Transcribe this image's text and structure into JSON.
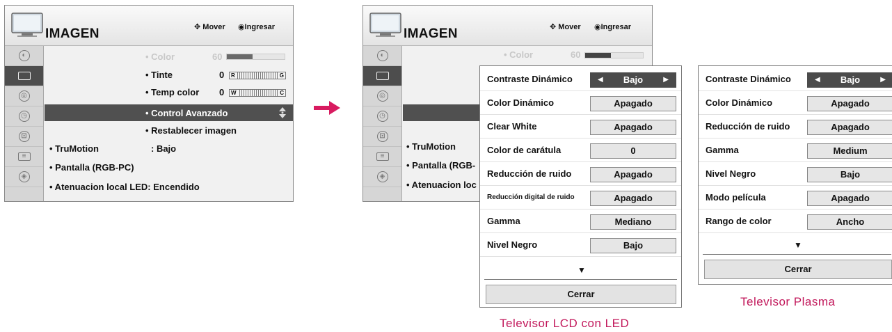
{
  "menu": {
    "title": "IMAGEN",
    "hint_move": "Mover",
    "hint_enter": "Ingresar",
    "sidebar_icons": [
      "picture-settings-icon",
      "picture-icon",
      "audio-icon",
      "time-icon",
      "lock-icon",
      "option-icon",
      "input-icon"
    ],
    "selected_icon_index": 1,
    "items": {
      "color": "• Color",
      "color_value": "60",
      "color_level": 0.6,
      "tint": "• Tinte",
      "tint_value": "0",
      "tint_left": "R",
      "tint_right": "G",
      "temp": "• Temp color",
      "temp_value": "0",
      "temp_left": "W",
      "temp_right": "C",
      "advanced": "• Control Avanzado",
      "reset": "• Restablecer imagen",
      "trumotion": "• TruMotion",
      "trumotion_value": ": Bajo",
      "screen": "• Pantalla (RGB-PC)",
      "led": "• Atenuacion local LED: Encendido"
    },
    "partial": {
      "trumotion": "• TruMotion",
      "screen": "• Pantalla (RGB-",
      "led": "• Atenuacion loc"
    }
  },
  "lcd_popup": {
    "rows": [
      {
        "label": "Contraste Dinámico",
        "value": "Bajo",
        "active": true
      },
      {
        "label": "Color Dinámico",
        "value": "Apagado"
      },
      {
        "label": "Clear White",
        "value": "Apagado"
      },
      {
        "label": "Color de carátula",
        "value": "0"
      },
      {
        "label": "Reducción de ruido",
        "value": "Apagado"
      },
      {
        "label": "Reducción digital de ruido",
        "value": "Apagado"
      },
      {
        "label": "Gamma",
        "value": "Mediano"
      },
      {
        "label": "Nivel Negro",
        "value": "Bajo"
      }
    ],
    "more": "▼",
    "close": "Cerrar",
    "caption": "Televisor LCD con LED"
  },
  "plasma_popup": {
    "rows": [
      {
        "label": "Contraste Dinámico",
        "value": "Bajo",
        "active": true
      },
      {
        "label": "Color Dinámico",
        "value": "Apagado"
      },
      {
        "label": "Reducción de ruido",
        "value": "Apagado"
      },
      {
        "label": "Gamma",
        "value": "Medium"
      },
      {
        "label": "Nivel Negro",
        "value": "Bajo"
      },
      {
        "label": "Modo película",
        "value": "Apagado"
      },
      {
        "label": "Rango de color",
        "value": "Ancho"
      }
    ],
    "more": "▼",
    "close": "Cerrar",
    "caption": "Televisor Plasma"
  },
  "colors": {
    "highlight": "#505050",
    "caption": "#c2185b",
    "arrow": "#d81b60"
  }
}
